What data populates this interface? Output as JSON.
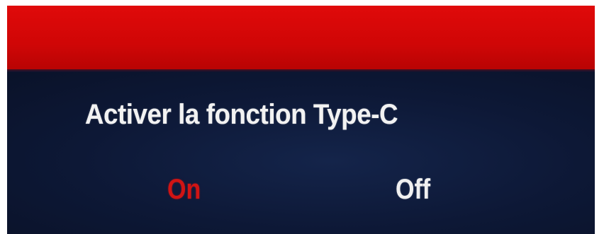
{
  "dialog": {
    "prompt": "Activer la fonction Type-C",
    "options": [
      {
        "label": "On",
        "selected": true
      },
      {
        "label": "Off",
        "selected": false
      }
    ]
  },
  "colors": {
    "header_red": "#e00a0a",
    "background_navy": "#0b1430",
    "selected_option": "#d01414",
    "unselected_option": "#f0f0f0",
    "prompt_text": "#f2f2f2"
  }
}
